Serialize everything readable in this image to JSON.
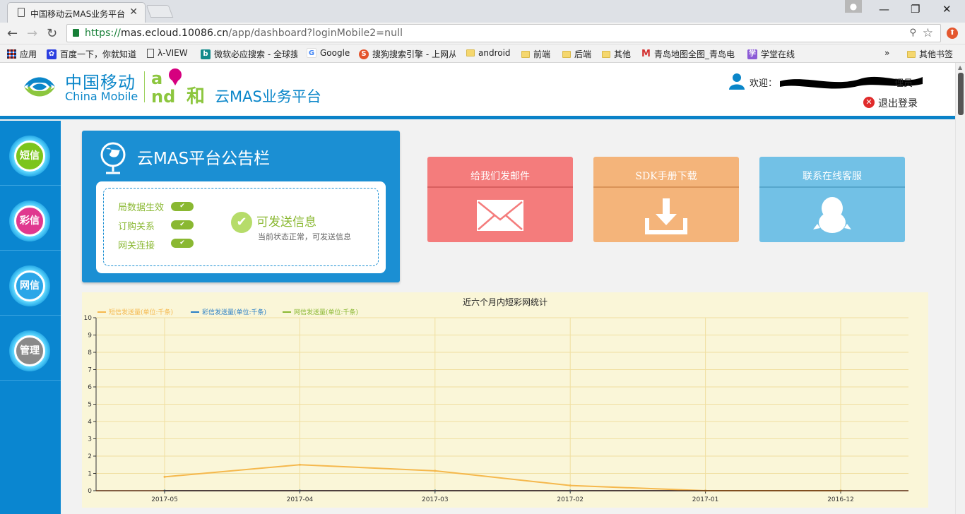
{
  "browser": {
    "tab_title": "中国移动云MAS业务平台",
    "url_scheme": "https://",
    "url_host": "mas.ecloud.10086.cn",
    "url_path": "/app/dashboard?loginMobile2=null",
    "bookmarks": [
      {
        "label": "应用",
        "icon": "apps-grid-icon"
      },
      {
        "label": "百度一下，你就知道",
        "icon": "baidu-paw-icon"
      },
      {
        "label": "λ-VIEW",
        "icon": "page-icon"
      },
      {
        "label": "微软必应搜索 - 全球搜",
        "icon": "bing-icon"
      },
      {
        "label": "Google",
        "icon": "google-icon"
      },
      {
        "label": "搜狗搜索引擎 - 上网从",
        "icon": "sogou-icon"
      },
      {
        "label": "android",
        "icon": "folder-icon"
      },
      {
        "label": "前端",
        "icon": "folder-icon"
      },
      {
        "label": "后端",
        "icon": "folder-icon"
      },
      {
        "label": "其他",
        "icon": "folder-icon"
      },
      {
        "label": "青岛地图全图_青岛电",
        "icon": "map-m-icon"
      },
      {
        "label": "学堂在线",
        "icon": "xuetang-icon"
      }
    ],
    "overflow_label": "»",
    "other_bookmarks": "其他书签"
  },
  "header": {
    "brand_cn": "中国移动",
    "brand_en": "China Mobile",
    "and_text": "和",
    "platform_title": "云MAS业务平台",
    "welcome_label": "欢迎：",
    "role_suffix": "理员",
    "logout_label": "退出登录"
  },
  "sidebar": {
    "items": [
      {
        "label": "短信",
        "color": "#7cc51c"
      },
      {
        "label": "彩信",
        "color": "#e0388f"
      },
      {
        "label": "网信",
        "color": "#2aa6e8"
      },
      {
        "label": "管理",
        "color": "#8a8a8a"
      }
    ]
  },
  "notice": {
    "title": "云MAS平台公告栏",
    "statuses": [
      {
        "label": "局数据生效",
        "check": "✔"
      },
      {
        "label": "订购关系",
        "check": "✔"
      },
      {
        "label": "网关连接",
        "check": "✔"
      }
    ],
    "ok_title": "可发送信息",
    "ok_subtitle": "当前状态正常，可发送信息"
  },
  "actions": [
    {
      "label": "给我们发邮件",
      "icon": "envelope-icon",
      "color": "#f47c7c"
    },
    {
      "label": "SDK手册下载",
      "icon": "download-icon",
      "color": "#f4b47a"
    },
    {
      "label": "联系在线客服",
      "icon": "qq-penguin-icon",
      "color": "#72c1e6"
    }
  ],
  "chart_data": {
    "type": "line",
    "title": "近六个月内短彩网统计",
    "categories": [
      "2017-05",
      "2017-04",
      "2017-03",
      "2017-02",
      "2017-01",
      "2016-12"
    ],
    "series": [
      {
        "name": "短信发送量(单位:千条)",
        "color": "#f5b84d",
        "values": [
          0.8,
          1.5,
          1.15,
          0.3,
          0,
          0
        ]
      },
      {
        "name": "彩信发送量(单位:千条)",
        "color": "#2a7fc6",
        "values": [
          0,
          0,
          0,
          0,
          0,
          0
        ]
      },
      {
        "name": "网信发送量(单位:千条)",
        "color": "#8ab832",
        "values": [
          0,
          0,
          0,
          0,
          0,
          0
        ]
      }
    ],
    "ylim": [
      0,
      10
    ],
    "yticks": [
      "0",
      "1",
      "2",
      "3",
      "4",
      "5",
      "6",
      "7",
      "8",
      "9",
      "10"
    ],
    "grid": true,
    "legend_position": "top-left"
  }
}
